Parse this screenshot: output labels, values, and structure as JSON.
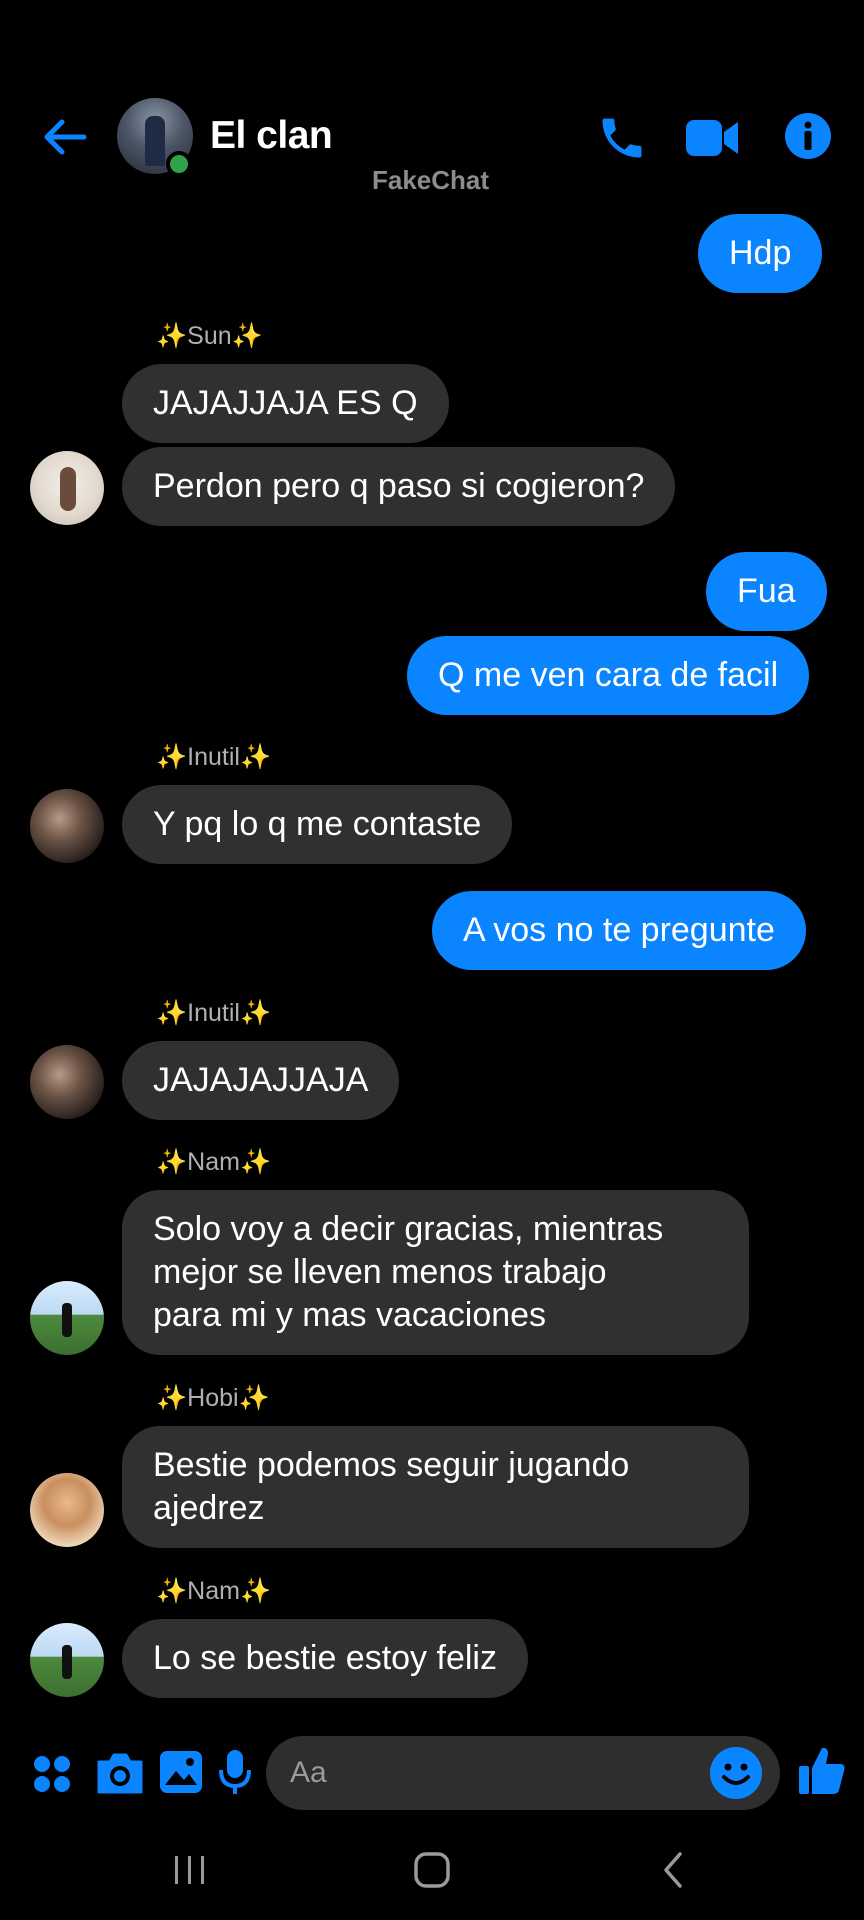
{
  "header": {
    "title": "El clan",
    "watermark": "FakeChat",
    "icons": [
      "back-arrow-icon",
      "phone-icon",
      "video-camera-icon",
      "info-icon"
    ],
    "accent": "#0a84ff",
    "online_color": "#31a24c"
  },
  "messages": [
    {
      "side": "out",
      "text": "Hdp"
    },
    {
      "side": "in",
      "sender": "Sun",
      "texts": [
        "JAJAJJAJA ES Q",
        "Perdon pero q paso si cogieron?"
      ]
    },
    {
      "side": "out",
      "texts": [
        "Fua",
        "Q me ven cara de facil"
      ]
    },
    {
      "side": "in",
      "sender": "Inutil",
      "text": "Y pq lo q me contaste"
    },
    {
      "side": "out",
      "text": "A vos no te pregunte"
    },
    {
      "side": "in",
      "sender": "Inutil",
      "text": "JAJAJAJJAJA"
    },
    {
      "side": "in",
      "sender": "Nam",
      "lines": [
        "Solo voy a decir gracias, mientras",
        "mejor se lleven menos trabajo",
        "para mi y mas vacaciones"
      ]
    },
    {
      "side": "in",
      "sender": "Hobi",
      "lines": [
        "Bestie podemos seguir jugando",
        "ajedrez"
      ]
    },
    {
      "side": "in",
      "sender": "Nam",
      "text": "Lo se bestie estoy feliz"
    }
  ],
  "sparkle": "✨",
  "composer": {
    "placeholder": "Aa",
    "icons": [
      "apps-grid-icon",
      "camera-icon",
      "gallery-icon",
      "microphone-icon",
      "emoji-icon",
      "thumbs-up-icon"
    ]
  },
  "system_nav": {
    "icons": [
      "recents-icon",
      "home-icon",
      "back-icon"
    ]
  },
  "colors": {
    "incoming_bubble": "#303030",
    "outgoing_bubble": "#0a84ff",
    "background": "#000000"
  }
}
